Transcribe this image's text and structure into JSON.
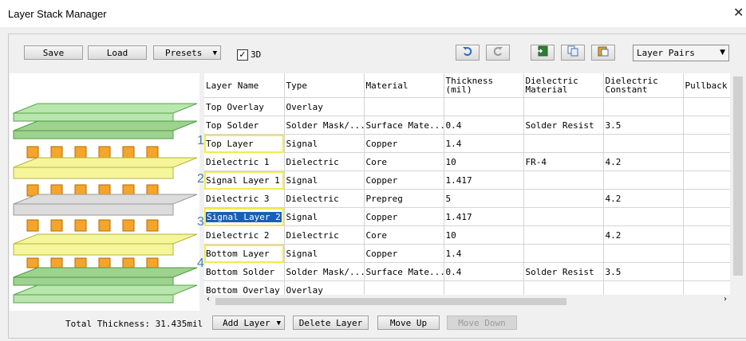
{
  "window": {
    "title": "Layer Stack Manager",
    "close_glyph": "✕"
  },
  "toolbar": {
    "save": "Save",
    "load": "Load",
    "presets": "Presets",
    "check_3d": "3D",
    "check_glyph": "✓",
    "undo_icon": "undo-icon",
    "redo_icon": "redo-icon",
    "view": "Layer Pairs"
  },
  "layer_numbers": [
    "1",
    "2",
    "3",
    "4"
  ],
  "table": {
    "columns": [
      {
        "label": "Layer Name"
      },
      {
        "label": "Type"
      },
      {
        "label": "Material"
      },
      {
        "label": "Thickness\n(mil)"
      },
      {
        "label": "Dielectric\nMaterial"
      },
      {
        "label": "Dielectric\nConstant"
      },
      {
        "label": "Pullback"
      }
    ],
    "rows": [
      {
        "name": "Top Overlay",
        "type": "Overlay",
        "material": "",
        "thickness": "",
        "dmat": "",
        "dconst": ""
      },
      {
        "name": "Top Solder",
        "type": "Solder Mask/...",
        "material": "Surface Mate...",
        "thickness": "0.4",
        "dmat": "Solder Resist",
        "dconst": "3.5"
      },
      {
        "name": "Top Layer",
        "type": "Signal",
        "material": "Copper",
        "thickness": "1.4",
        "dmat": "",
        "dconst": ""
      },
      {
        "name": "Dielectric 1",
        "type": "Dielectric",
        "material": "Core",
        "thickness": "10",
        "dmat": "FR-4",
        "dconst": "4.2"
      },
      {
        "name": "Signal Layer 1",
        "type": "Signal",
        "material": "Copper",
        "thickness": "1.417",
        "dmat": "",
        "dconst": ""
      },
      {
        "name": "Dielectric 3",
        "type": "Dielectric",
        "material": "Prepreg",
        "thickness": "5",
        "dmat": "",
        "dconst": "4.2"
      },
      {
        "name": "Signal Layer 2",
        "type": "Signal",
        "material": "Copper",
        "thickness": "1.417",
        "dmat": "",
        "dconst": ""
      },
      {
        "name": "Dielectric 2",
        "type": "Dielectric",
        "material": "Core",
        "thickness": "10",
        "dmat": "",
        "dconst": "4.2"
      },
      {
        "name": "Bottom Layer",
        "type": "Signal",
        "material": "Copper",
        "thickness": "1.4",
        "dmat": "",
        "dconst": ""
      },
      {
        "name": "Bottom Solder",
        "type": "Solder Mask/...",
        "material": "Surface Mate...",
        "thickness": "0.4",
        "dmat": "Solder Resist",
        "dconst": "3.5"
      },
      {
        "name": "Bottom Overlay",
        "type": "Overlay",
        "material": "",
        "thickness": "",
        "dmat": "",
        "dconst": ""
      }
    ]
  },
  "footer": {
    "total": "Total Thickness: 31.435mil",
    "add_layer": "Add Layer",
    "delete_layer": "Delete Layer",
    "move_up": "Move Up",
    "move_down": "Move Down"
  },
  "colors": {
    "selection": "#1a5fb4",
    "highlight": "#f2ea4e",
    "copper": "#f4a52a",
    "mask": "#a5d99a",
    "dielectric": "#f5f59a",
    "prepreg": "#dcdcdc"
  }
}
